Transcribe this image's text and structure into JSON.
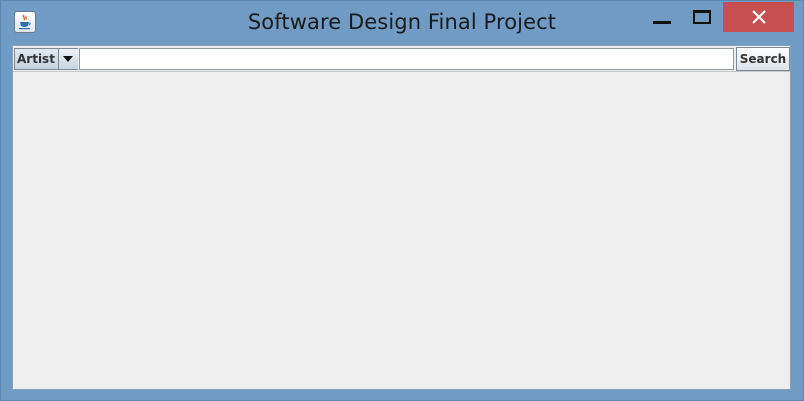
{
  "window": {
    "title": "Software Design Final Project",
    "app_icon": "java-cup-icon",
    "controls": {
      "minimize_icon": "minimize-icon",
      "maximize_icon": "maximize-icon",
      "close_icon": "close-icon"
    }
  },
  "toolbar": {
    "search_type": {
      "selected": "Artist",
      "arrow_icon": "chevron-down-icon"
    },
    "search_input": {
      "value": "",
      "placeholder": ""
    },
    "search_label": "Search"
  },
  "colors": {
    "titlebar": "#6f9bc4",
    "close_button": "#c74f4f",
    "panel_background": "#eeeeee"
  }
}
